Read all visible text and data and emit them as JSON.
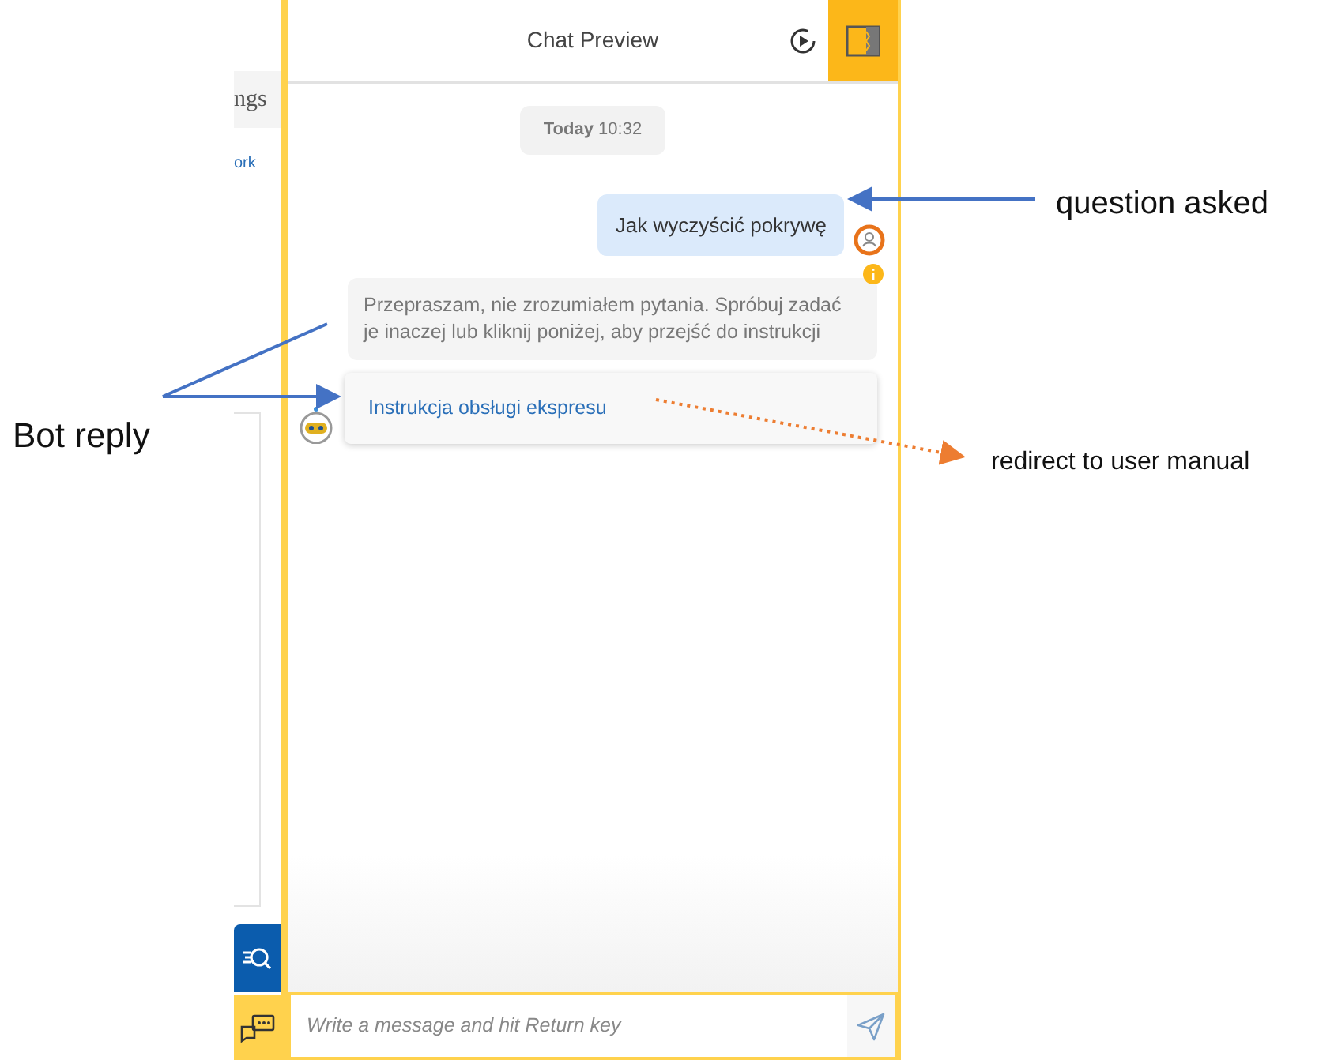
{
  "sidebar": {
    "texts": [
      "ngs",
      "ork"
    ]
  },
  "chat": {
    "title": "Chat Preview",
    "messages": [
      {
        "kind": "timestamp",
        "label": "Today",
        "time": "10:32"
      },
      {
        "kind": "user",
        "text": "Jak wyczyścić pokrywę"
      },
      {
        "kind": "bot",
        "text": "Przepraszam, nie zrozumiałem pytania. Spróbuj zadać je inaczej lub kliknij poniżej, aby przejść do instrukcji"
      },
      {
        "kind": "link",
        "text": "Instrukcja obsługi ekspresu"
      }
    ],
    "input": {
      "placeholder": "Write a message and hit Return key"
    }
  },
  "annotations": [
    {
      "text": "question asked"
    },
    {
      "text": "Bot reply"
    },
    {
      "text": "redirect to user manual"
    }
  ]
}
